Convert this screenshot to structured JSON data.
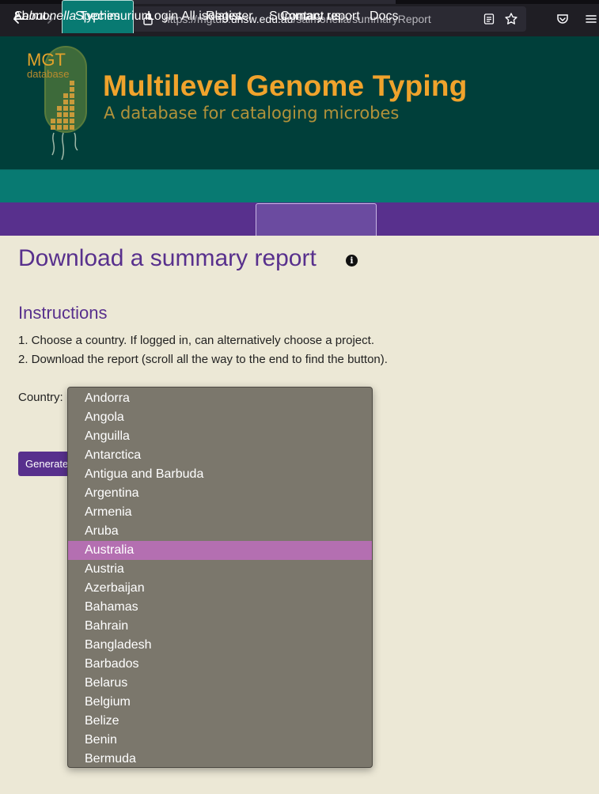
{
  "browser": {
    "url_prefix": "https://mgtdb.",
    "url_domain": "unsw.edu.au",
    "url_path": "/salmonella/summaryReport"
  },
  "header": {
    "logo_text": "MGT",
    "logo_subtext": "database",
    "title": "Multilevel Genome Typing",
    "subtitle": "A database for cataloging microbes"
  },
  "nav_primary": {
    "items": [
      {
        "label": "About"
      },
      {
        "label": "Species"
      },
      {
        "label": "Login"
      },
      {
        "label": "Register"
      },
      {
        "label": "Contact us"
      },
      {
        "label": "Docs"
      }
    ],
    "active": "Species"
  },
  "nav_secondary": {
    "genus": "Salmonella",
    "species": " Typhimurium",
    "items": [
      {
        "label": "All isolates"
      },
      {
        "label": "Summary report"
      }
    ],
    "active": "Summary report"
  },
  "main": {
    "title": "Download a summary report",
    "info_icon": "info-icon",
    "instructions_title": "Instructions",
    "steps": [
      "1. Choose a country. If logged in, can alternatively choose a project.",
      "2. Download the report (scroll all the way to the end to find the button)."
    ],
    "country_label": "Country:",
    "generate_label": "Generate"
  },
  "country_select": {
    "selected": "Australia",
    "options": [
      "Andorra",
      "Angola",
      "Anguilla",
      "Antarctica",
      "Antigua and Barbuda",
      "Argentina",
      "Armenia",
      "Aruba",
      "Australia",
      "Austria",
      "Azerbaijan",
      "Bahamas",
      "Bahrain",
      "Bangladesh",
      "Barbados",
      "Belarus",
      "Belgium",
      "Belize",
      "Benin",
      "Bermuda"
    ]
  },
  "colors": {
    "banner": "#003f3a",
    "title_orange": "#f0a32c",
    "nav_teal": "#087a72",
    "nav_purple": "#58308d",
    "page_bg": "#ece8d6",
    "dropdown_bg": "#7b776c",
    "selected_option": "#b46fb1"
  }
}
